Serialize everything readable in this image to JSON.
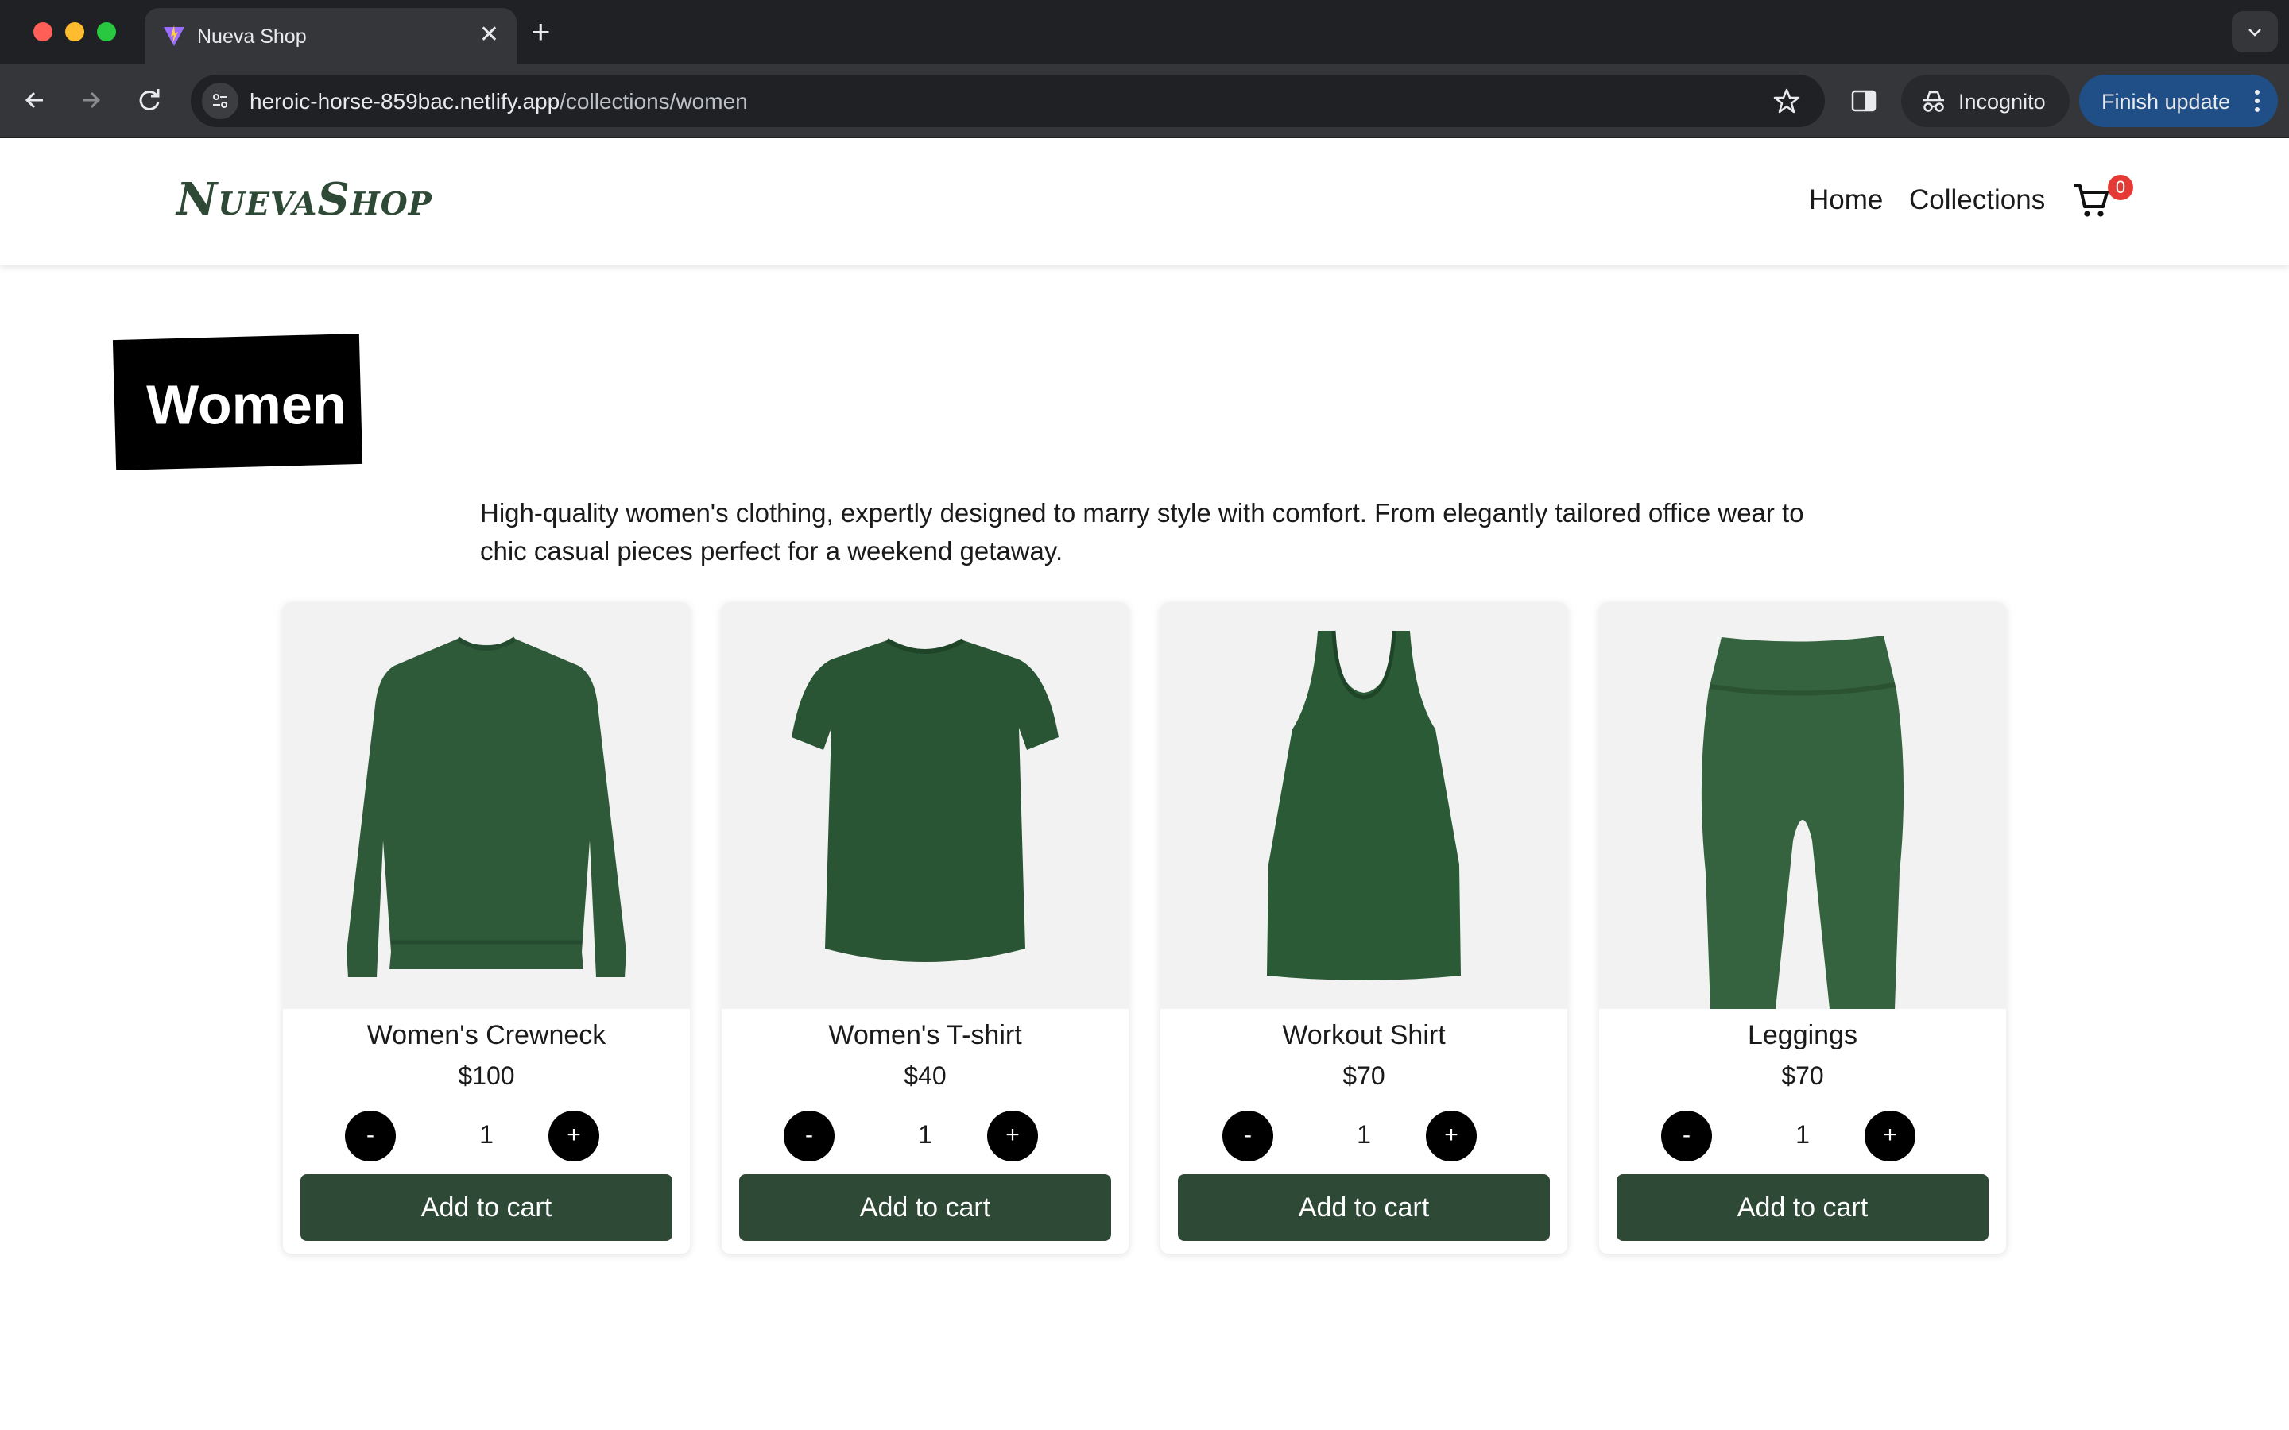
{
  "browser": {
    "tab_title": "Nueva Shop",
    "new_tab_glyph": "+",
    "close_glyph": "✕",
    "url_host": "heroic-horse-859bac.netlify.app",
    "url_path": "/collections/women",
    "incognito_label": "Incognito",
    "finish_update_label": "Finish update",
    "colors": {
      "frame": "#202124",
      "toolbar": "#35363a",
      "update_button": "#1f4f86"
    }
  },
  "header": {
    "logo": "NuevaShop",
    "nav": {
      "home": "Home",
      "collections": "Collections"
    },
    "cart_count": "0",
    "colors": {
      "brand": "#2e4a36",
      "badge": "#e53935"
    }
  },
  "collection": {
    "title": "Women",
    "description": "High-quality women's clothing, expertly designed to marry style with comfort. From elegantly tailored office wear to chic casual pieces perfect for a weekend getaway."
  },
  "products": [
    {
      "name": "Women's Crewneck",
      "price": "$100",
      "quantity": "1",
      "minus": "-",
      "plus": "+",
      "add_label": "Add to cart",
      "image": "crewneck-sweatshirt-image"
    },
    {
      "name": "Women's T-shirt",
      "price": "$40",
      "quantity": "1",
      "minus": "-",
      "plus": "+",
      "add_label": "Add to cart",
      "image": "tshirt-image"
    },
    {
      "name": "Workout Shirt",
      "price": "$70",
      "quantity": "1",
      "minus": "-",
      "plus": "+",
      "add_label": "Add to cart",
      "image": "tank-top-image"
    },
    {
      "name": "Leggings",
      "price": "$70",
      "quantity": "1",
      "minus": "-",
      "plus": "+",
      "add_label": "Add to cart",
      "image": "leggings-image"
    }
  ],
  "colors": {
    "product_green": "#2f5a3a",
    "button": "#2e4a36",
    "image_bg": "#f2f2f2"
  }
}
